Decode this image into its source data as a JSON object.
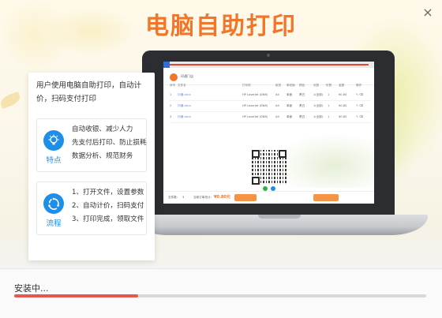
{
  "app": {
    "title": "电脑自助打印",
    "close_label": "×"
  },
  "card": {
    "intro": "用户使用电脑自助打印，自动计价，扫码支付打印",
    "features": {
      "label": "特点",
      "icon": "lightbulb-icon",
      "lines": [
        "自动收银、减少人力",
        "先支付后打印、防止损耗",
        "数据分析、规范财务"
      ]
    },
    "process": {
      "label": "流程",
      "icon": "cycle-icon",
      "lines": [
        "1、打开文件，设置参数",
        "2、自动计价，扫码支付",
        "3、打印完成，领取文件"
      ]
    }
  },
  "screen_app": {
    "name": "印通门店",
    "columns": [
      "序号",
      "文件名",
      "打印机",
      "纸张",
      "单双面",
      "颜色",
      "页数",
      "份数",
      "金额",
      "操作"
    ],
    "rows": [
      {
        "no": "1",
        "file": "印通.docx",
        "printer": "HP LaserJet (DN8)",
        "paper": "A4",
        "side": "单面",
        "color": "黑白",
        "pages": "1(全部)",
        "copies": "1",
        "amount": "¥0.80"
      },
      {
        "no": "2",
        "file": "印通.docx",
        "printer": "HP LaserJet (DN8)",
        "paper": "A4",
        "side": "单面",
        "color": "黑白",
        "pages": "1(全部)",
        "copies": "1",
        "amount": "¥0.80"
      },
      {
        "no": "3",
        "file": "印通.docx",
        "printer": "HP LaserJet (DN8)",
        "paper": "A4",
        "side": "单面",
        "color": "黑白",
        "pages": "1(全部)",
        "copies": "1",
        "amount": "¥0.80"
      }
    ],
    "file_count_label": "文件数：",
    "file_count": "3",
    "total_label": "当前订单总计：",
    "total_price": "¥0.80元",
    "colors": {
      "accent": "#f2762a",
      "button": "#f49545",
      "wechat": "#2bb24c",
      "alipay": "#1d8fe8"
    }
  },
  "footer": {
    "status": "安装中...",
    "progress_percent": 30,
    "colors": {
      "progress": "#e8574d",
      "track": "#d9d9d9"
    }
  }
}
